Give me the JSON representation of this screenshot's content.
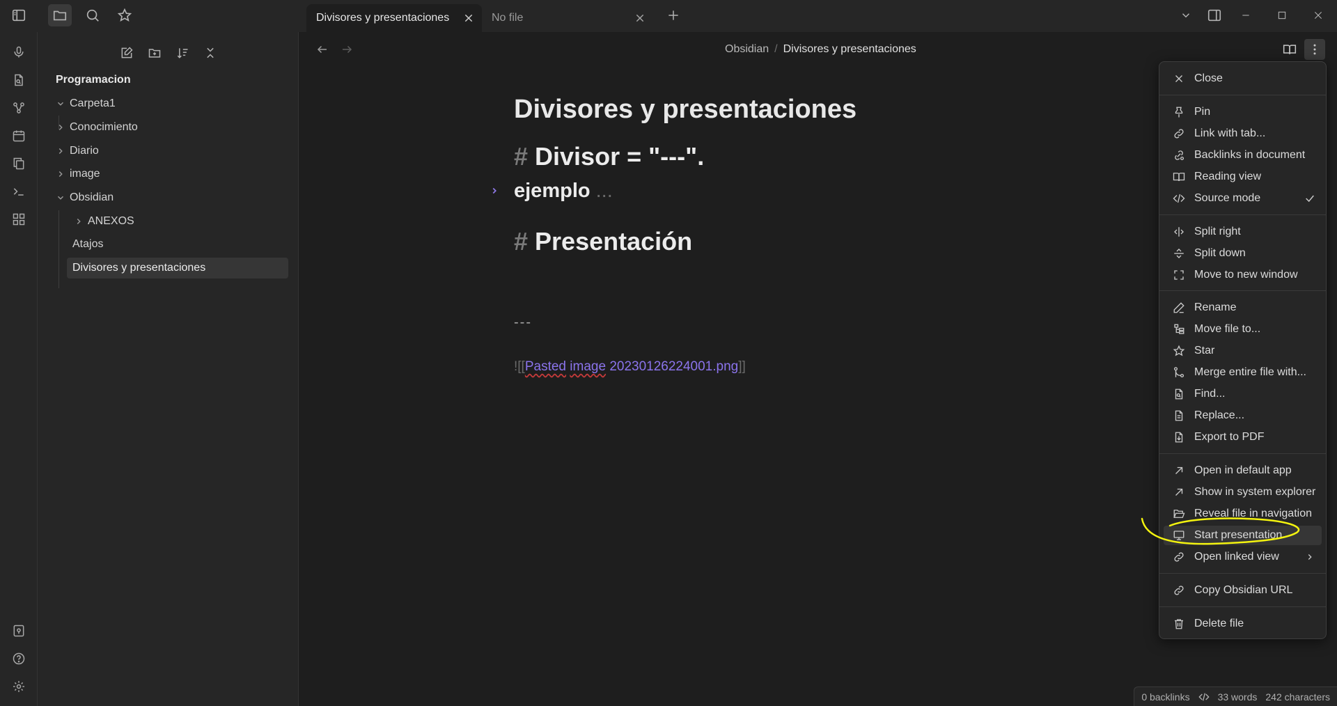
{
  "tabs": [
    {
      "label": "Divisores y presentaciones",
      "active": true
    },
    {
      "label": "No file",
      "active": false
    }
  ],
  "explorer": {
    "vault_name": "Programacion",
    "items": [
      {
        "label": "Carpeta1",
        "type": "folder",
        "expanded": true
      },
      {
        "label": "Conocimiento",
        "type": "folder",
        "expanded": false
      },
      {
        "label": "Diario",
        "type": "folder",
        "expanded": false
      },
      {
        "label": "image",
        "type": "folder",
        "expanded": false
      },
      {
        "label": "Obsidian",
        "type": "folder",
        "expanded": true
      },
      {
        "label": "ANEXOS",
        "type": "folder",
        "expanded": false
      },
      {
        "label": "Atajos",
        "type": "file"
      },
      {
        "label": "Divisores y presentaciones",
        "type": "file",
        "selected": true
      }
    ]
  },
  "breadcrumb": {
    "parent": "Obsidian",
    "separator": "/",
    "current": "Divisores y presentaciones"
  },
  "doc": {
    "title": "Divisores y presentaciones",
    "h1_a": "Divisor = \"---\".",
    "hash": "#",
    "h2_text": "ejemplo",
    "fold_dots": "...",
    "h1_b": "Presentación",
    "hr": "---",
    "embed_open": "![[",
    "embed_word1": "Pasted",
    "embed_word2": "image",
    "embed_rest": "20230126224001.png",
    "embed_close": "]]"
  },
  "status": {
    "backlinks": "0 backlinks",
    "words": "33 words",
    "characters": "242 characters"
  },
  "menu": {
    "items": [
      {
        "label": "Close",
        "icon": "close-icon"
      },
      {
        "label": "Pin",
        "icon": "pin-icon"
      },
      {
        "label": "Link with tab...",
        "icon": "link-icon"
      },
      {
        "label": "Backlinks in document",
        "icon": "backlinks-icon"
      },
      {
        "label": "Reading view",
        "icon": "book-open-icon"
      },
      {
        "label": "Source mode",
        "icon": "code-icon",
        "checked": true
      },
      {
        "label": "Split right",
        "icon": "split-right-icon"
      },
      {
        "label": "Split down",
        "icon": "split-down-icon"
      },
      {
        "label": "Move to new window",
        "icon": "maximize-icon"
      },
      {
        "label": "Rename",
        "icon": "pencil-icon"
      },
      {
        "label": "Move file to...",
        "icon": "folder-tree-icon"
      },
      {
        "label": "Star",
        "icon": "star-icon"
      },
      {
        "label": "Merge entire file with...",
        "icon": "git-merge-icon"
      },
      {
        "label": "Find...",
        "icon": "file-search-icon"
      },
      {
        "label": "Replace...",
        "icon": "file-replace-icon"
      },
      {
        "label": "Export to PDF",
        "icon": "file-download-icon"
      },
      {
        "label": "Open in default app",
        "icon": "arrow-up-right-icon"
      },
      {
        "label": "Show in system explorer",
        "icon": "arrow-up-right-icon"
      },
      {
        "label": "Reveal file in navigation",
        "icon": "folder-open-icon"
      },
      {
        "label": "Start presentation",
        "icon": "monitor-icon",
        "highlighted": true
      },
      {
        "label": "Open linked view",
        "icon": "link-icon",
        "submenu": true
      },
      {
        "label": "Copy Obsidian URL",
        "icon": "link-icon"
      },
      {
        "label": "Delete file",
        "icon": "trash-icon"
      }
    ]
  },
  "colors": {
    "accent": "#8b74ec",
    "annotation": "#f3f30f",
    "background": "#1e1e1e",
    "panel": "#262626"
  }
}
